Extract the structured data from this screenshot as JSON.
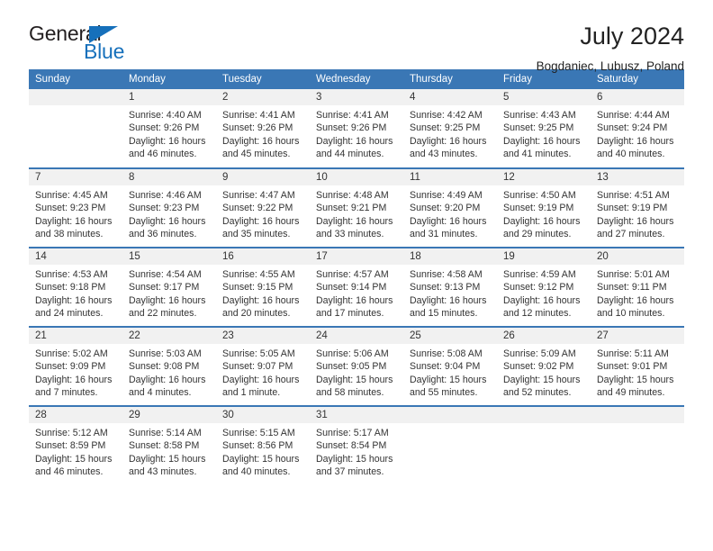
{
  "brand": {
    "name_dark": "General",
    "name_blue": "Blue",
    "triangle_color": "#1670bb"
  },
  "header": {
    "title": "July 2024",
    "subtitle": "Bogdaniec, Lubusz, Poland"
  },
  "theme": {
    "header_blue": "#3a77b5",
    "daynum_band": "#f1f1f1",
    "text": "#333333"
  },
  "calendar": {
    "weekday_headers": [
      "Sunday",
      "Monday",
      "Tuesday",
      "Wednesday",
      "Thursday",
      "Friday",
      "Saturday"
    ],
    "weeks": [
      [
        {
          "day": "",
          "sunrise": "",
          "sunset": "",
          "daylight_line1": "",
          "daylight_line2": ""
        },
        {
          "day": "1",
          "sunrise": "Sunrise: 4:40 AM",
          "sunset": "Sunset: 9:26 PM",
          "daylight_line1": "Daylight: 16 hours",
          "daylight_line2": "and 46 minutes."
        },
        {
          "day": "2",
          "sunrise": "Sunrise: 4:41 AM",
          "sunset": "Sunset: 9:26 PM",
          "daylight_line1": "Daylight: 16 hours",
          "daylight_line2": "and 45 minutes."
        },
        {
          "day": "3",
          "sunrise": "Sunrise: 4:41 AM",
          "sunset": "Sunset: 9:26 PM",
          "daylight_line1": "Daylight: 16 hours",
          "daylight_line2": "and 44 minutes."
        },
        {
          "day": "4",
          "sunrise": "Sunrise: 4:42 AM",
          "sunset": "Sunset: 9:25 PM",
          "daylight_line1": "Daylight: 16 hours",
          "daylight_line2": "and 43 minutes."
        },
        {
          "day": "5",
          "sunrise": "Sunrise: 4:43 AM",
          "sunset": "Sunset: 9:25 PM",
          "daylight_line1": "Daylight: 16 hours",
          "daylight_line2": "and 41 minutes."
        },
        {
          "day": "6",
          "sunrise": "Sunrise: 4:44 AM",
          "sunset": "Sunset: 9:24 PM",
          "daylight_line1": "Daylight: 16 hours",
          "daylight_line2": "and 40 minutes."
        }
      ],
      [
        {
          "day": "7",
          "sunrise": "Sunrise: 4:45 AM",
          "sunset": "Sunset: 9:23 PM",
          "daylight_line1": "Daylight: 16 hours",
          "daylight_line2": "and 38 minutes."
        },
        {
          "day": "8",
          "sunrise": "Sunrise: 4:46 AM",
          "sunset": "Sunset: 9:23 PM",
          "daylight_line1": "Daylight: 16 hours",
          "daylight_line2": "and 36 minutes."
        },
        {
          "day": "9",
          "sunrise": "Sunrise: 4:47 AM",
          "sunset": "Sunset: 9:22 PM",
          "daylight_line1": "Daylight: 16 hours",
          "daylight_line2": "and 35 minutes."
        },
        {
          "day": "10",
          "sunrise": "Sunrise: 4:48 AM",
          "sunset": "Sunset: 9:21 PM",
          "daylight_line1": "Daylight: 16 hours",
          "daylight_line2": "and 33 minutes."
        },
        {
          "day": "11",
          "sunrise": "Sunrise: 4:49 AM",
          "sunset": "Sunset: 9:20 PM",
          "daylight_line1": "Daylight: 16 hours",
          "daylight_line2": "and 31 minutes."
        },
        {
          "day": "12",
          "sunrise": "Sunrise: 4:50 AM",
          "sunset": "Sunset: 9:19 PM",
          "daylight_line1": "Daylight: 16 hours",
          "daylight_line2": "and 29 minutes."
        },
        {
          "day": "13",
          "sunrise": "Sunrise: 4:51 AM",
          "sunset": "Sunset: 9:19 PM",
          "daylight_line1": "Daylight: 16 hours",
          "daylight_line2": "and 27 minutes."
        }
      ],
      [
        {
          "day": "14",
          "sunrise": "Sunrise: 4:53 AM",
          "sunset": "Sunset: 9:18 PM",
          "daylight_line1": "Daylight: 16 hours",
          "daylight_line2": "and 24 minutes."
        },
        {
          "day": "15",
          "sunrise": "Sunrise: 4:54 AM",
          "sunset": "Sunset: 9:17 PM",
          "daylight_line1": "Daylight: 16 hours",
          "daylight_line2": "and 22 minutes."
        },
        {
          "day": "16",
          "sunrise": "Sunrise: 4:55 AM",
          "sunset": "Sunset: 9:15 PM",
          "daylight_line1": "Daylight: 16 hours",
          "daylight_line2": "and 20 minutes."
        },
        {
          "day": "17",
          "sunrise": "Sunrise: 4:57 AM",
          "sunset": "Sunset: 9:14 PM",
          "daylight_line1": "Daylight: 16 hours",
          "daylight_line2": "and 17 minutes."
        },
        {
          "day": "18",
          "sunrise": "Sunrise: 4:58 AM",
          "sunset": "Sunset: 9:13 PM",
          "daylight_line1": "Daylight: 16 hours",
          "daylight_line2": "and 15 minutes."
        },
        {
          "day": "19",
          "sunrise": "Sunrise: 4:59 AM",
          "sunset": "Sunset: 9:12 PM",
          "daylight_line1": "Daylight: 16 hours",
          "daylight_line2": "and 12 minutes."
        },
        {
          "day": "20",
          "sunrise": "Sunrise: 5:01 AM",
          "sunset": "Sunset: 9:11 PM",
          "daylight_line1": "Daylight: 16 hours",
          "daylight_line2": "and 10 minutes."
        }
      ],
      [
        {
          "day": "21",
          "sunrise": "Sunrise: 5:02 AM",
          "sunset": "Sunset: 9:09 PM",
          "daylight_line1": "Daylight: 16 hours",
          "daylight_line2": "and 7 minutes."
        },
        {
          "day": "22",
          "sunrise": "Sunrise: 5:03 AM",
          "sunset": "Sunset: 9:08 PM",
          "daylight_line1": "Daylight: 16 hours",
          "daylight_line2": "and 4 minutes."
        },
        {
          "day": "23",
          "sunrise": "Sunrise: 5:05 AM",
          "sunset": "Sunset: 9:07 PM",
          "daylight_line1": "Daylight: 16 hours",
          "daylight_line2": "and 1 minute."
        },
        {
          "day": "24",
          "sunrise": "Sunrise: 5:06 AM",
          "sunset": "Sunset: 9:05 PM",
          "daylight_line1": "Daylight: 15 hours",
          "daylight_line2": "and 58 minutes."
        },
        {
          "day": "25",
          "sunrise": "Sunrise: 5:08 AM",
          "sunset": "Sunset: 9:04 PM",
          "daylight_line1": "Daylight: 15 hours",
          "daylight_line2": "and 55 minutes."
        },
        {
          "day": "26",
          "sunrise": "Sunrise: 5:09 AM",
          "sunset": "Sunset: 9:02 PM",
          "daylight_line1": "Daylight: 15 hours",
          "daylight_line2": "and 52 minutes."
        },
        {
          "day": "27",
          "sunrise": "Sunrise: 5:11 AM",
          "sunset": "Sunset: 9:01 PM",
          "daylight_line1": "Daylight: 15 hours",
          "daylight_line2": "and 49 minutes."
        }
      ],
      [
        {
          "day": "28",
          "sunrise": "Sunrise: 5:12 AM",
          "sunset": "Sunset: 8:59 PM",
          "daylight_line1": "Daylight: 15 hours",
          "daylight_line2": "and 46 minutes."
        },
        {
          "day": "29",
          "sunrise": "Sunrise: 5:14 AM",
          "sunset": "Sunset: 8:58 PM",
          "daylight_line1": "Daylight: 15 hours",
          "daylight_line2": "and 43 minutes."
        },
        {
          "day": "30",
          "sunrise": "Sunrise: 5:15 AM",
          "sunset": "Sunset: 8:56 PM",
          "daylight_line1": "Daylight: 15 hours",
          "daylight_line2": "and 40 minutes."
        },
        {
          "day": "31",
          "sunrise": "Sunrise: 5:17 AM",
          "sunset": "Sunset: 8:54 PM",
          "daylight_line1": "Daylight: 15 hours",
          "daylight_line2": "and 37 minutes."
        },
        {
          "day": "",
          "sunrise": "",
          "sunset": "",
          "daylight_line1": "",
          "daylight_line2": ""
        },
        {
          "day": "",
          "sunrise": "",
          "sunset": "",
          "daylight_line1": "",
          "daylight_line2": ""
        },
        {
          "day": "",
          "sunrise": "",
          "sunset": "",
          "daylight_line1": "",
          "daylight_line2": ""
        }
      ]
    ]
  }
}
